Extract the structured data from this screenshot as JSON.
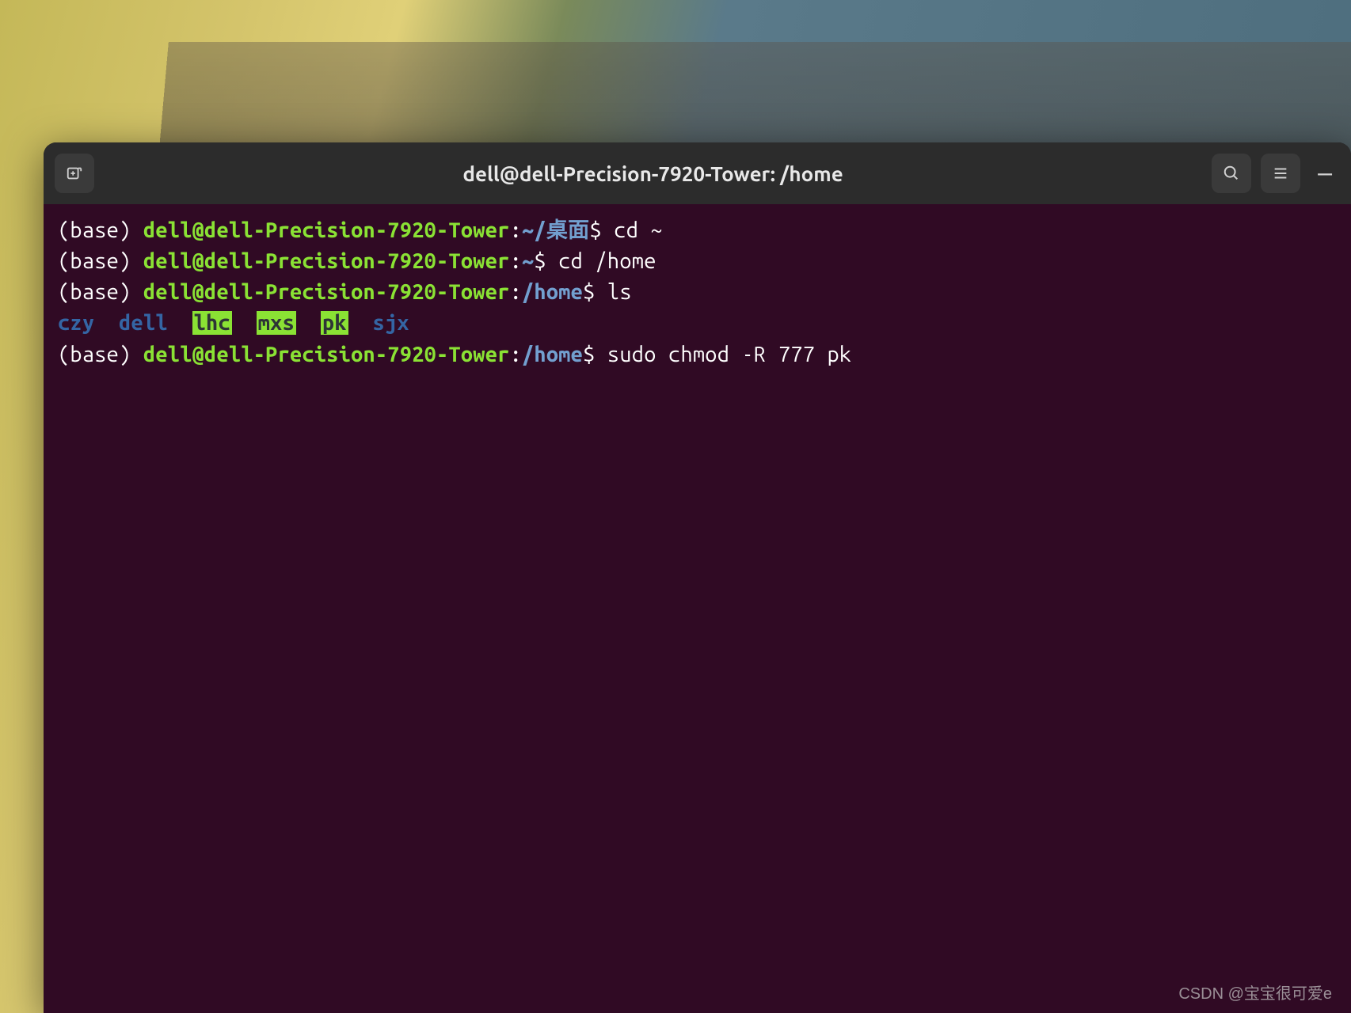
{
  "titlebar": {
    "title": "dell@dell-Precision-7920-Tower: /home",
    "new_tab_icon": "new-tab-icon",
    "search_icon": "search-icon",
    "menu_icon": "menu-icon",
    "minimize_icon": "minimize-icon"
  },
  "terminal": {
    "lines": [
      {
        "base": "(base) ",
        "user_host": "dell@dell-Precision-7920-Tower",
        "colon": ":",
        "path_tilde": "~",
        "path_suffix": "/桌面",
        "prompt": "$",
        "command": " cd ~"
      },
      {
        "base": "(base) ",
        "user_host": "dell@dell-Precision-7920-Tower",
        "colon": ":",
        "path_tilde": "~",
        "prompt": "$",
        "command": " cd /home"
      },
      {
        "base": "(base) ",
        "user_host": "dell@dell-Precision-7920-Tower",
        "colon": ":",
        "path": "/home",
        "prompt": "$",
        "command": " ls"
      },
      {
        "base": "(base) ",
        "user_host": "dell@dell-Precision-7920-Tower",
        "colon": ":",
        "path": "/home",
        "prompt": "$",
        "command": " sudo chmod -R 777 pk"
      }
    ],
    "ls_output": {
      "czy": "czy",
      "dell": "dell",
      "lhc": "lhc",
      "mxs": "mxs",
      "pk": "pk",
      "sjx": "sjx"
    }
  },
  "watermark": "CSDN @宝宝很可爱e"
}
